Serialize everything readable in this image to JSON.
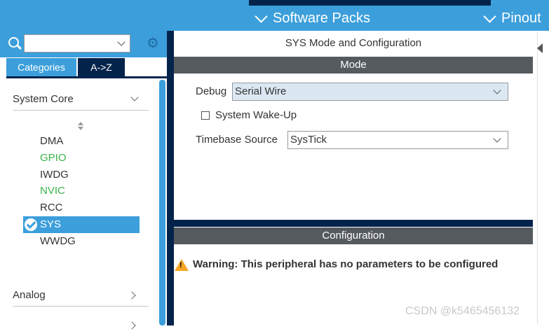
{
  "menu": {
    "software_packs": "Software Packs",
    "pinout": "Pinout"
  },
  "left": {
    "search_value": "",
    "tabs": [
      "Categories",
      "A->Z"
    ],
    "categories": [
      {
        "label": "System Core",
        "expanded": true
      },
      {
        "label": "Analog",
        "expanded": false
      }
    ],
    "peripherals": [
      {
        "label": "DMA",
        "state": "normal"
      },
      {
        "label": "GPIO",
        "state": "configured"
      },
      {
        "label": "IWDG",
        "state": "normal"
      },
      {
        "label": "NVIC",
        "state": "configured"
      },
      {
        "label": "RCC",
        "state": "normal"
      },
      {
        "label": "SYS",
        "state": "selected"
      },
      {
        "label": "WWDG",
        "state": "normal"
      }
    ]
  },
  "right": {
    "title": "SYS Mode and Configuration",
    "mode_header": "Mode",
    "debug_label": "Debug",
    "debug_value": "Serial Wire",
    "wakeup_label": "System Wake-Up",
    "wakeup_checked": false,
    "timebase_label": "Timebase Source",
    "timebase_value": "SysTick",
    "config_header": "Configuration",
    "warning": "Warning: This peripheral has no parameters to be configured"
  },
  "watermark": "CSDN @k5465456132",
  "colors": {
    "navy": "#03234b",
    "accent": "#3c9fdb",
    "configured": "#3bb44a",
    "warning": "#f5a623"
  },
  "icons": {
    "search": "search-icon",
    "settings": "gear-icon",
    "selected": "check-circle-icon",
    "warning": "warning-icon"
  }
}
